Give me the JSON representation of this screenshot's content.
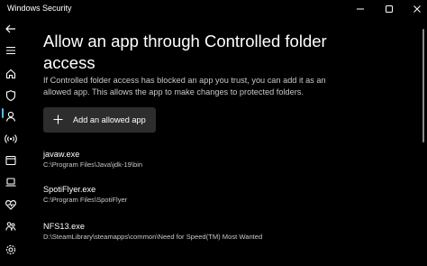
{
  "window": {
    "title": "Windows Security"
  },
  "page": {
    "title": "Allow an app through Controlled folder access",
    "description": "If Controlled folder access has blocked an app you trust, you can add it as an allowed app. This allows the app to make changes to protected folders.",
    "add_button_label": "Add an allowed app"
  },
  "allowed_apps": [
    {
      "name": "javaw.exe",
      "path": "C:\\Program Files\\Java\\jdk-19\\bin"
    },
    {
      "name": "SpotiFlyer.exe",
      "path": "C:\\Program Files\\SpotiFlyer"
    },
    {
      "name": "NFS13.exe",
      "path": "D:\\SteamLibrary\\steamapps\\common\\Need for Speed(TM) Most Wanted"
    }
  ],
  "sidebar": {
    "active_item": "virus-threat-protection",
    "items": [
      "back-icon",
      "menu-icon",
      "home-icon",
      "shield-icon",
      "person-icon",
      "wifi-icon",
      "app-browser-icon",
      "laptop-icon",
      "heart-icon",
      "family-icon",
      "settings-icon"
    ]
  },
  "colors": {
    "background": "#000000",
    "button": "#2d2d2d",
    "accent": "#4cc2ff",
    "secondary_text": "#c8c8c8"
  }
}
